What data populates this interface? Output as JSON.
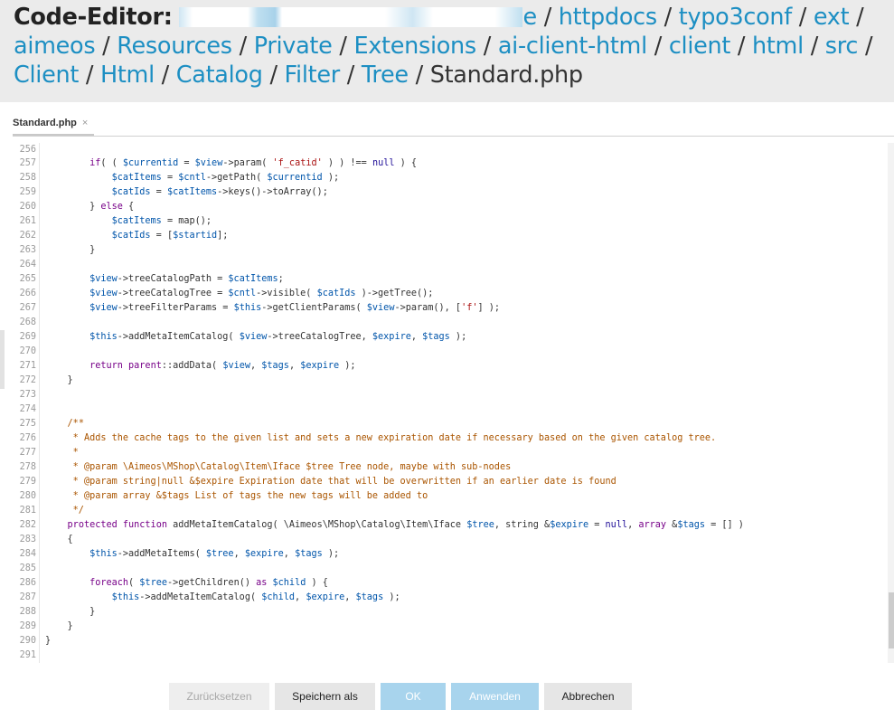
{
  "header": {
    "title_label": "Code-Editor:",
    "path_tail": "e",
    "path": [
      "httpdocs",
      "typo3conf",
      "ext",
      "aimeos",
      "Resources",
      "Private",
      "Extensions",
      "ai-client-html",
      "client",
      "html",
      "src",
      "Client",
      "Html",
      "Catalog",
      "Filter",
      "Tree"
    ],
    "separator": "/",
    "file_name": "Standard.php"
  },
  "tab": {
    "label": "Standard.php",
    "close": "×"
  },
  "editor": {
    "line_numbers": [
      "256",
      "257",
      "258",
      "259",
      "260",
      "261",
      "262",
      "263",
      "264",
      "265",
      "266",
      "267",
      "268",
      "269",
      "270",
      "271",
      "272",
      "273",
      "274",
      "275",
      "276",
      "277",
      "278",
      "279",
      "280",
      "281",
      "282",
      "283",
      "284",
      "285",
      "286",
      "287",
      "288",
      "289",
      "290",
      "291"
    ]
  },
  "buttons": {
    "reset": "Zurücksetzen",
    "save_as": "Speichern als",
    "ok": "OK",
    "apply": "Anwenden",
    "cancel": "Abbrechen"
  }
}
